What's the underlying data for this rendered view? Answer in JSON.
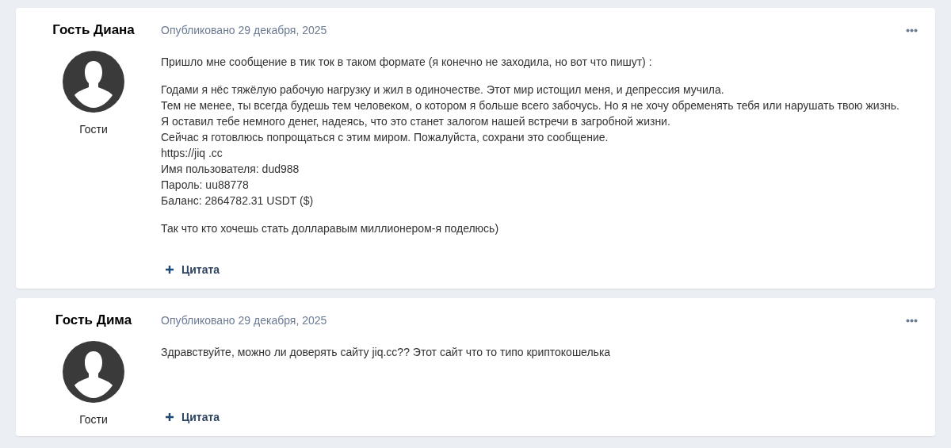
{
  "posts": [
    {
      "author": "Гость Диана",
      "group": "Гости",
      "date": "Опубликовано 29 декабря, 2025",
      "paragraphs": [
        [
          "Пришло мне сообщение в тик ток в таком формате (я конечно не заходила, но вот что пишут) :"
        ],
        [
          "Годами я нёс тяжёлую рабочую нагрузку и жил в одиночестве. Этот мир истощил меня, и депрессия мучила.",
          "Тем не менее, ты всегда будешь тем человеком, о котором я больше всего забочусь. Но я не хочу обременять тебя или нарушать твою жизнь.",
          "Я оставил тебе немного денег, надеясь, что это станет залогом нашей встречи в загробной жизни.",
          "Сейчас я готовлюсь попрощаться с этим миром. Пожалуйста, сохрани это сообщение.",
          "https://jiq .cc",
          "Имя пользователя: dud988",
          "Пароль: uu88778",
          "Баланс: 2864782.31 USDT ($)"
        ],
        [
          "Так что кто хочешь стать долларавым миллионером-я поделюсь)"
        ]
      ],
      "quote_label": "Цитата"
    },
    {
      "author": "Гость Дима",
      "group": "Гости",
      "date": "Опубликовано 29 декабря, 2025",
      "paragraphs": [
        [
          "Здравствуйте, можно ли доверять сайту jiq.cc?? Этот сайт что то типо криптокошелька"
        ]
      ],
      "quote_label": "Цитата"
    }
  ]
}
